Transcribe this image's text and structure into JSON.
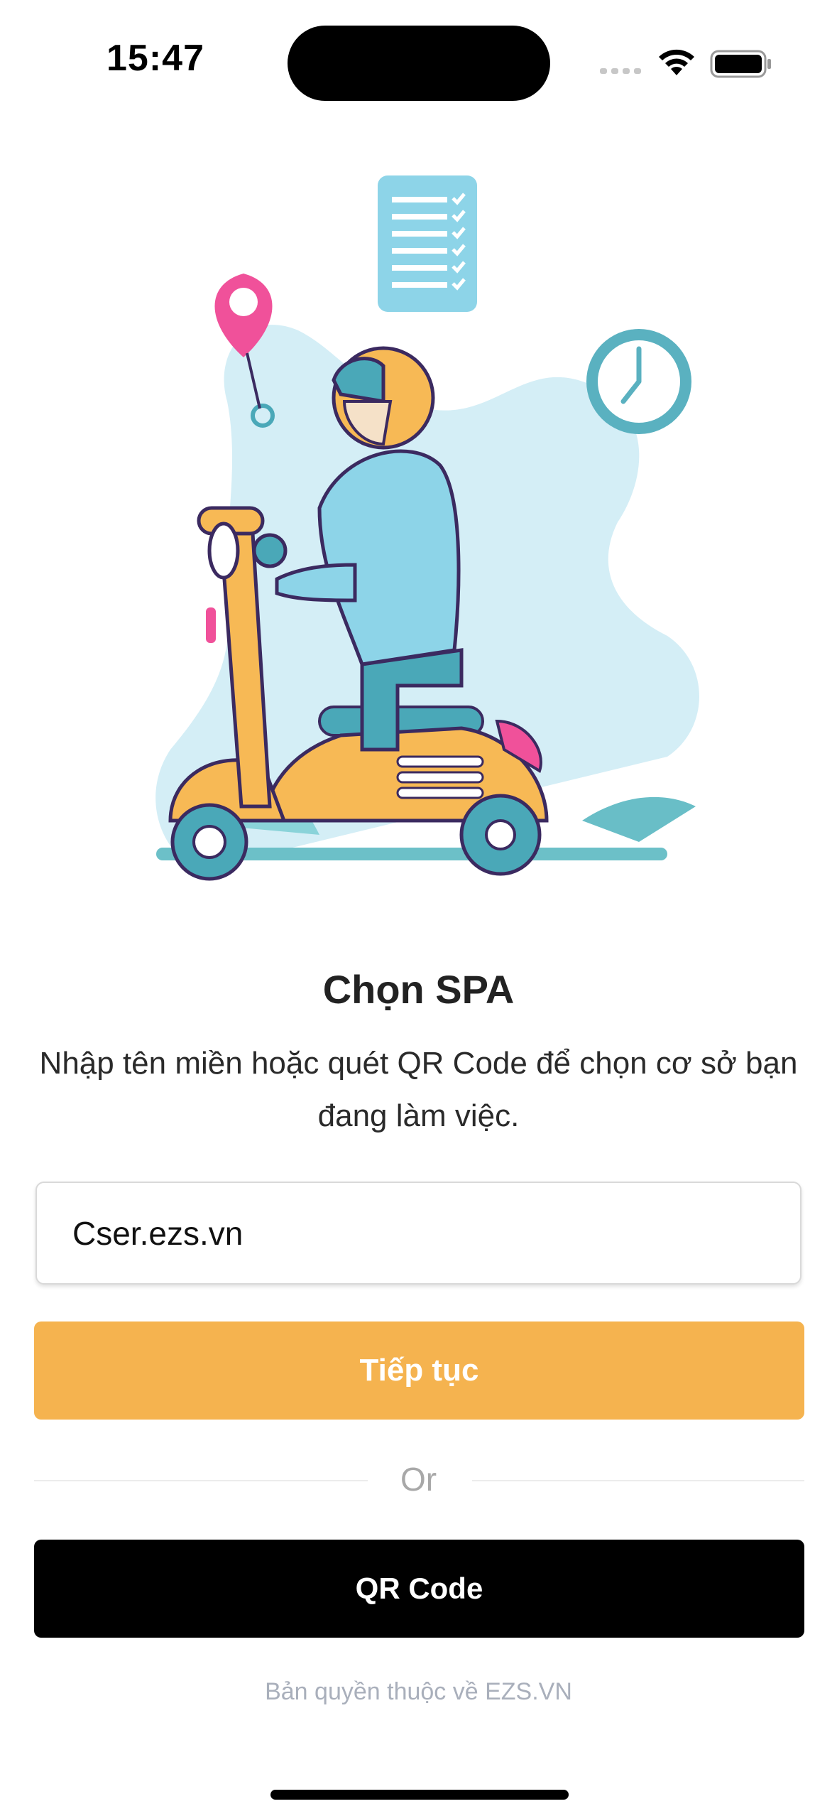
{
  "status_bar": {
    "time": "15:47"
  },
  "illustration": {
    "description_icon": "delivery-scooter-illustration"
  },
  "header": {
    "title": "Chọn SPA",
    "subtitle": "Nhập tên miền hoặc quét QR Code để chọn cơ sở bạn đang làm việc."
  },
  "form": {
    "domain_value": "Cser.ezs.vn",
    "continue_label": "Tiếp tục",
    "or_label": "Or",
    "qr_label": "QR Code"
  },
  "footer": {
    "copyright": "Bản quyền thuộc về EZS.VN"
  },
  "colors": {
    "accent": "#f5b34f",
    "primary_dark": "#000000",
    "muted": "#a9afbb"
  }
}
